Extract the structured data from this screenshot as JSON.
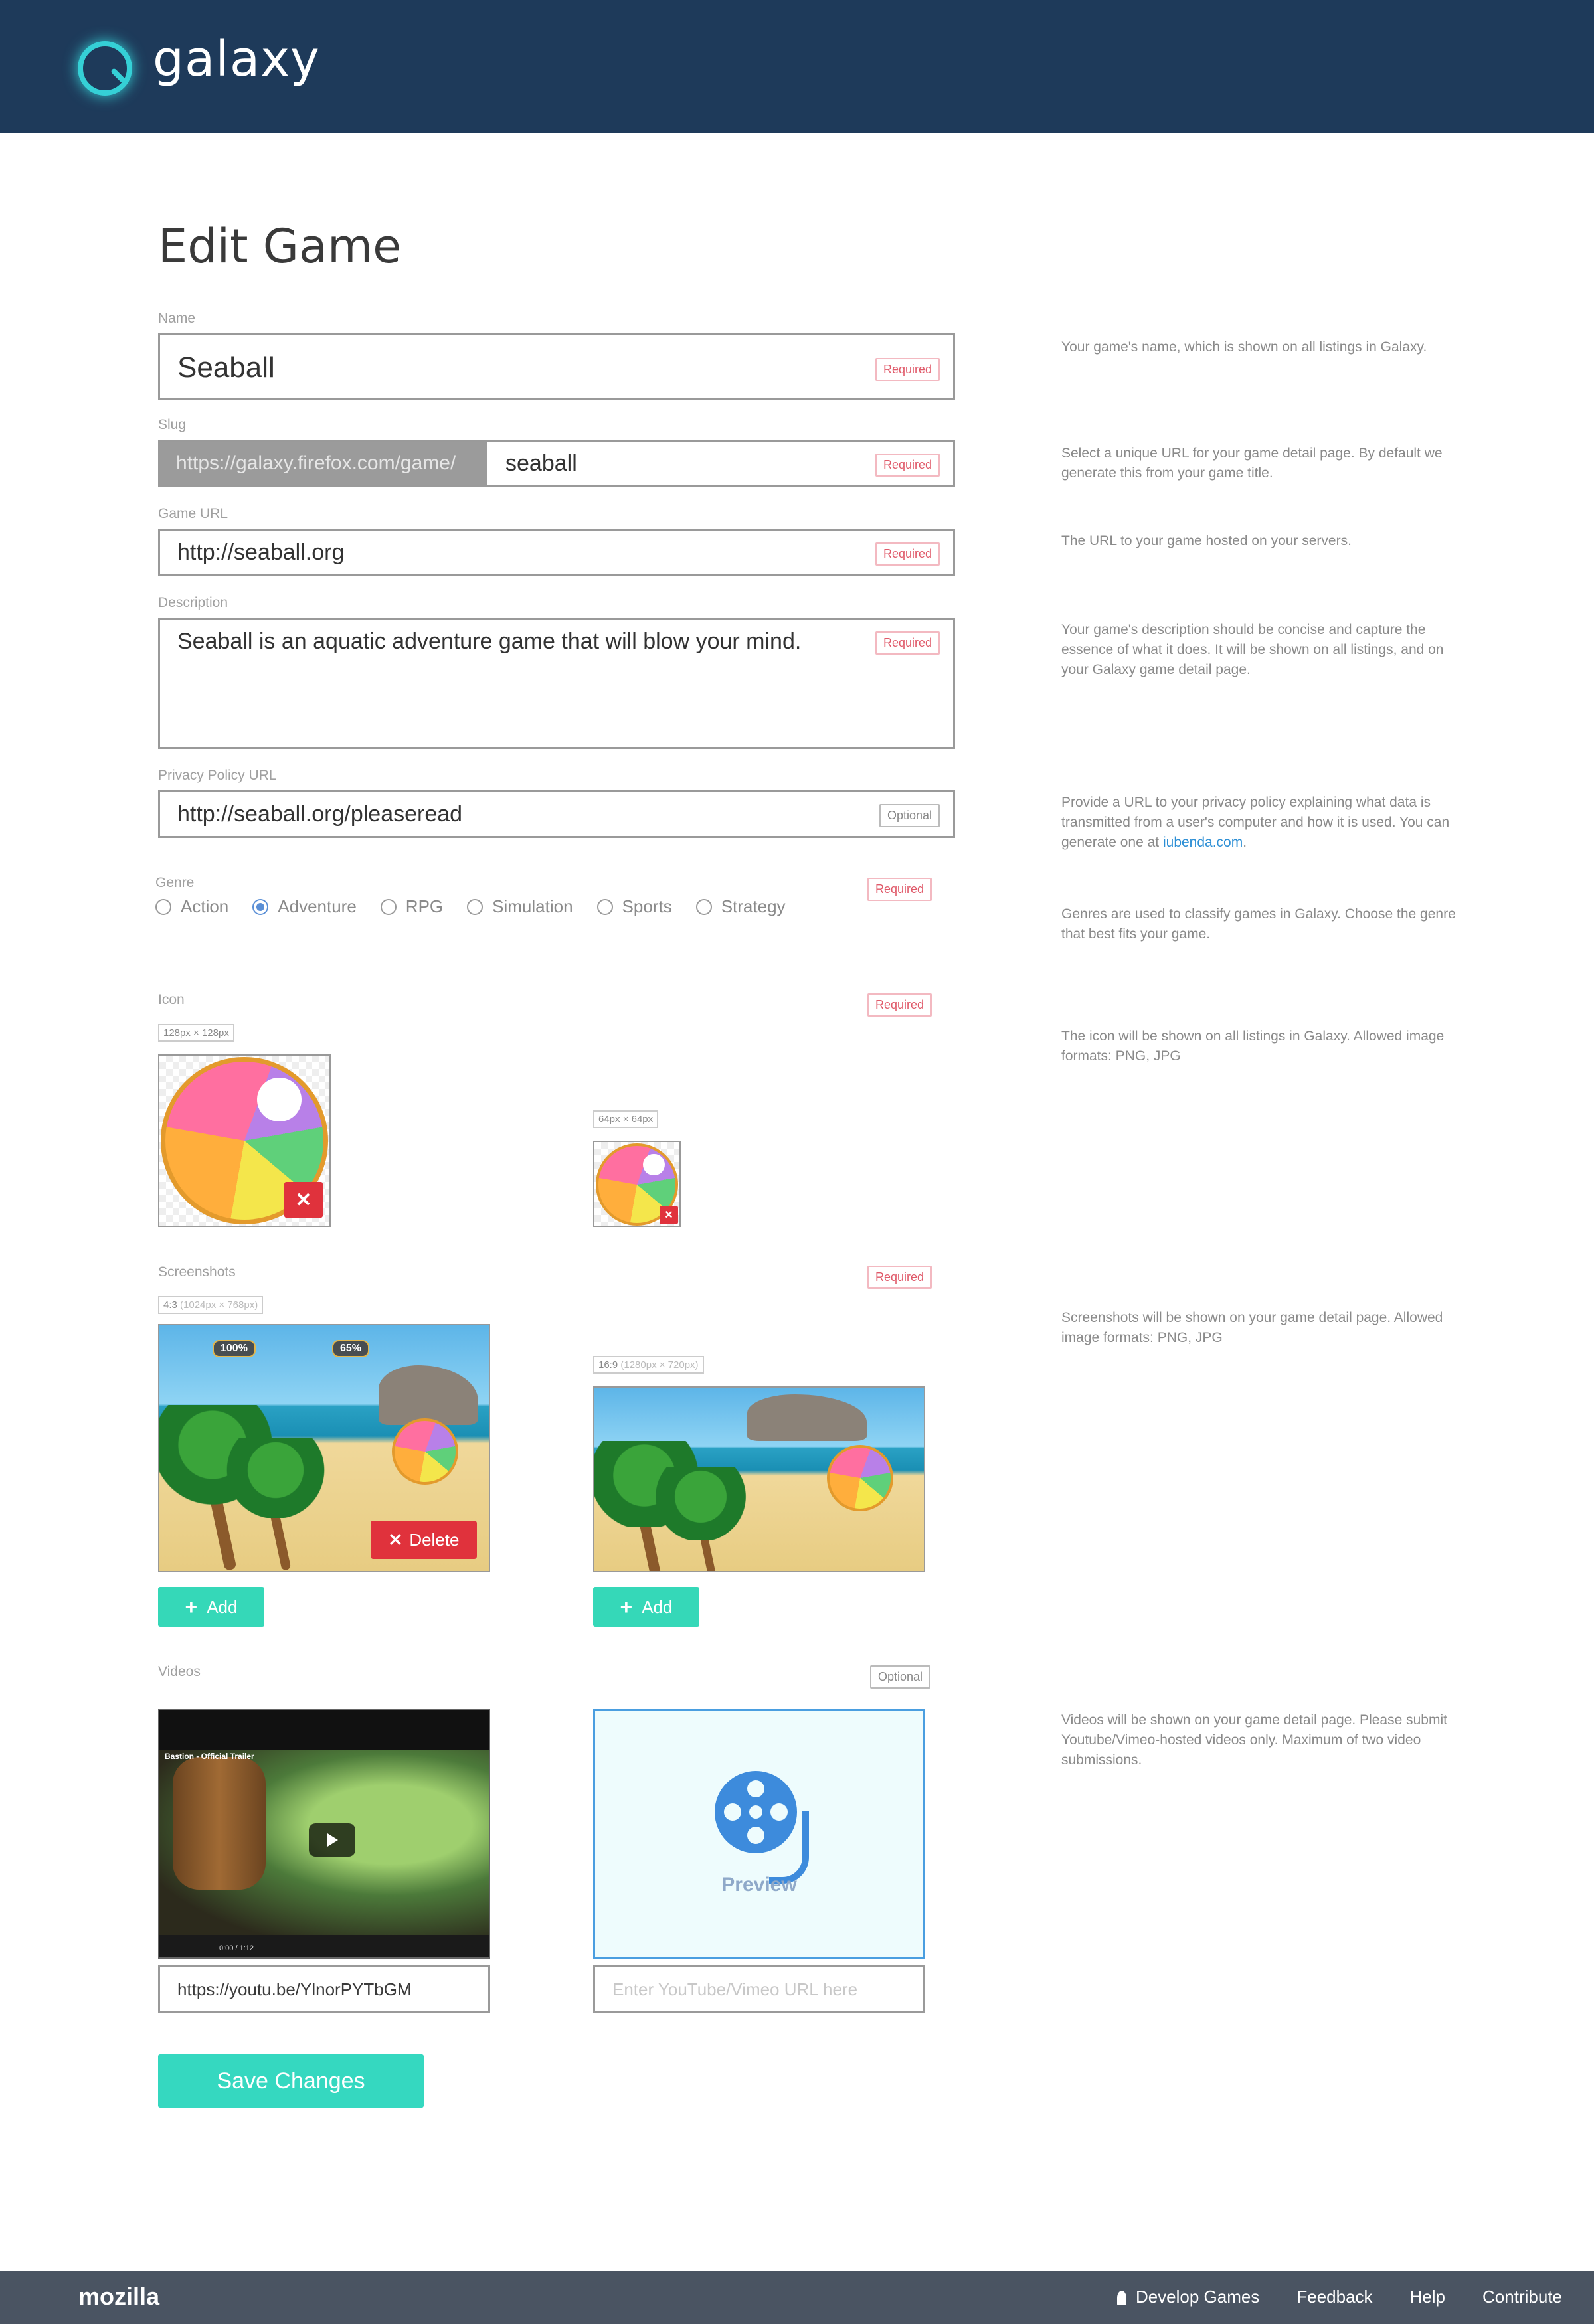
{
  "header": {
    "logo_text": "galaxy"
  },
  "page": {
    "title": "Edit Game"
  },
  "fields": {
    "name": {
      "label": "Name",
      "value": "Seaball",
      "badge": "Required",
      "help": "Your game's name, which is shown on all listings in Galaxy."
    },
    "slug": {
      "label": "Slug",
      "prefix": "https://galaxy.firefox.com/game/",
      "value": "seaball",
      "badge": "Required",
      "help": "Select a unique URL for your game detail page. By default we generate this from your game title."
    },
    "game_url": {
      "label": "Game URL",
      "value": "http://seaball.org",
      "badge": "Required",
      "help": "The URL to your game hosted on your servers."
    },
    "description": {
      "label": "Description",
      "value": "Seaball is an aquatic adventure game that will blow your mind.",
      "badge": "Required",
      "help": "Your game's description should be concise and capture the essence of what it does. It will be shown on all listings, and on your Galaxy game detail page."
    },
    "privacy": {
      "label": "Privacy Policy URL",
      "value": "http://seaball.org/pleaseread",
      "badge": "Optional",
      "help_pre": "Provide a URL to your privacy policy explaining what data is transmitted from a user's computer and how it is used. You can generate one at ",
      "help_link": "iubenda.com",
      "help_post": "."
    },
    "genre": {
      "label": "Genre",
      "badge": "Required",
      "options": [
        "Action",
        "Adventure",
        "RPG",
        "Simulation",
        "Sports",
        "Strategy"
      ],
      "selected": "Adventure",
      "help": "Genres are used to classify games in Galaxy. Choose the genre that best fits your game."
    },
    "icon": {
      "label": "Icon",
      "badge": "Required",
      "size_large": "128px × 128px",
      "size_small": "64px × 64px",
      "help": "The icon will be shown on all listings in Galaxy. Allowed image formats: PNG, JPG"
    },
    "screenshots": {
      "label": "Screenshots",
      "badge": "Required",
      "ratio_a": "4:3",
      "dims_a": "(1024px × 768px)",
      "ratio_b": "16:9",
      "dims_b": "(1280px × 720px)",
      "hud_left": "100%",
      "hud_right": "65%",
      "delete_label": "Delete",
      "add_label": "Add",
      "help": "Screenshots will be shown on your game detail page. Allowed image formats: PNG, JPG"
    },
    "videos": {
      "label": "Videos",
      "badge": "Optional",
      "video_title": "Bastion - Official Trailer",
      "video_time": "0:00 / 1:12",
      "url_value": "https://youtu.be/YlnorPYTbGM",
      "url_placeholder": "Enter YouTube/Vimeo URL here",
      "preview_label": "Preview",
      "help": "Videos will be shown on your game detail page. Please submit Youtube/Vimeo-hosted videos only. Maximum of two video submissions."
    }
  },
  "actions": {
    "save_label": "Save Changes"
  },
  "footer": {
    "logo": "mozilla",
    "links": [
      "Develop Games",
      "Feedback",
      "Help",
      "Contribute"
    ]
  },
  "colors": {
    "header_bg": "#1e3a5a",
    "accent_teal": "#35d8c0",
    "required_red": "#e05a6a",
    "delete_red": "#e0323c",
    "footer_bg": "#4a5462"
  }
}
